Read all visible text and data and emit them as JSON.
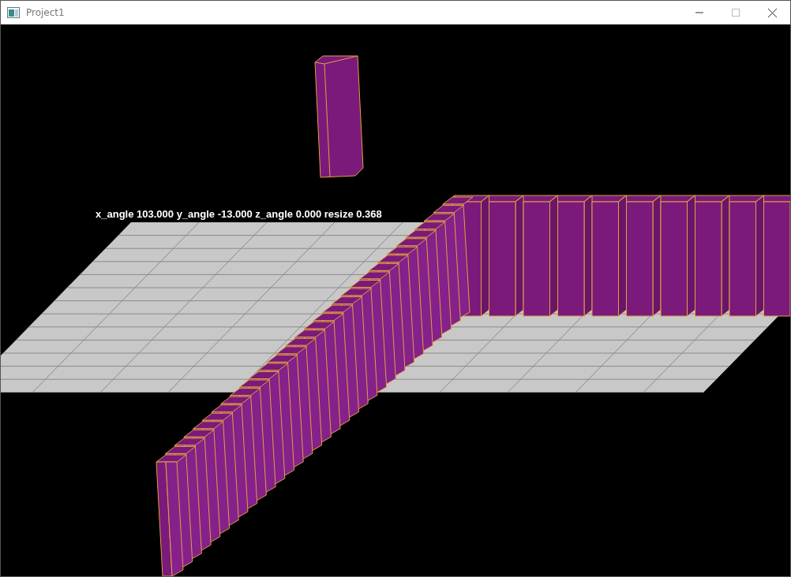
{
  "window": {
    "title": "Project1"
  },
  "viewport": {
    "status_text": "x_angle 103.000 y_angle -13.000 z_angle 0.000 resize 0.368"
  }
}
